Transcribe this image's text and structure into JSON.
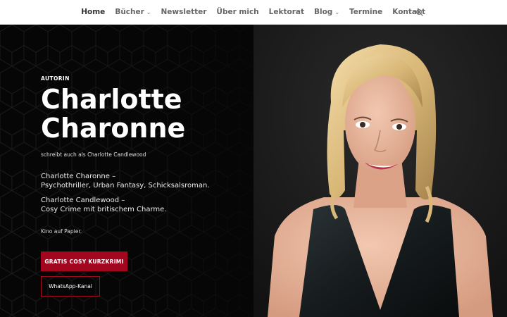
{
  "nav": {
    "items": [
      {
        "label": "Home",
        "active": true
      },
      {
        "label": "Bücher",
        "dropdown": true
      },
      {
        "label": "Newsletter"
      },
      {
        "label": "Über mich"
      },
      {
        "label": "Lektorat"
      },
      {
        "label": "Blog",
        "dropdown": true
      },
      {
        "label": "Termine"
      },
      {
        "label": "Kontakt"
      }
    ],
    "search_icon": "search-icon"
  },
  "hero": {
    "eyebrow": "AUTORIN",
    "name_line1": "Charlotte",
    "name_line2": "Charonne",
    "alias": "schreibt auch als Charlotte Candlewood",
    "desc1_line1": "Charlotte Charonne –",
    "desc1_line2": "Psychothriller, Urban Fantasy, Schicksalsroman.",
    "desc2_line1": "Charlotte Candlewood –",
    "desc2_line2": "Cosy Crime mit britischem Charme.",
    "tagline": "Kino auf Papier.",
    "primary_button": "GRATIS COSY KURZKRIMI",
    "secondary_button": "WhatsApp-Kanal"
  },
  "colors": {
    "accent": "#a3071f",
    "hero_bg": "#060606",
    "nav_text": "#666666"
  }
}
